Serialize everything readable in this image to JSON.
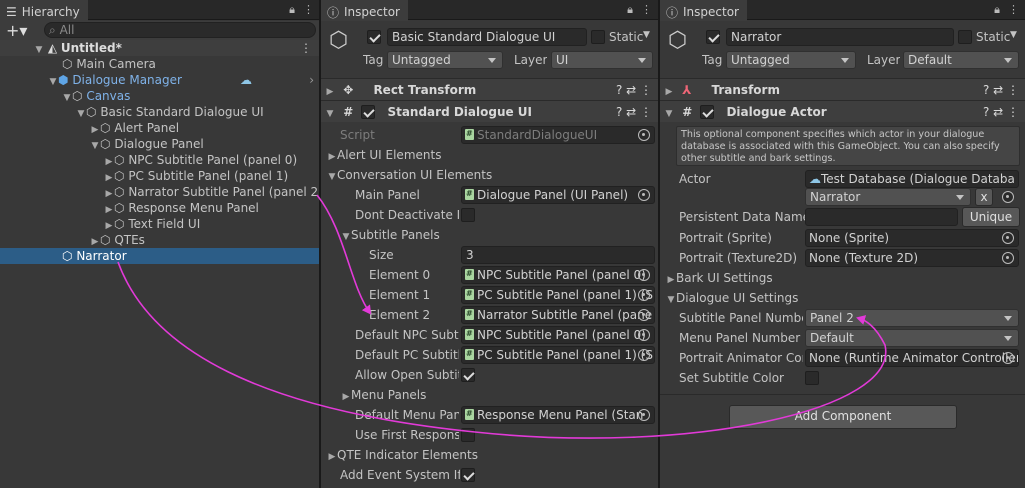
{
  "hierarchy": {
    "tab_label": "Hierarchy",
    "search_placeholder": "All",
    "scene": "Untitled*",
    "items": [
      {
        "label": "Main Camera"
      },
      {
        "label": "Dialogue Manager"
      },
      {
        "label": "Canvas"
      },
      {
        "label": "Basic Standard Dialogue UI"
      },
      {
        "label": "Alert Panel"
      },
      {
        "label": "Dialogue Panel"
      },
      {
        "label": "NPC Subtitle Panel (panel 0)"
      },
      {
        "label": "PC Subtitle Panel (panel 1)"
      },
      {
        "label": "Narrator Subtitle Panel (panel 2)"
      },
      {
        "label": "Response Menu Panel"
      },
      {
        "label": "Text Field UI"
      },
      {
        "label": "QTEs"
      },
      {
        "label": "Narrator"
      }
    ]
  },
  "inspector1": {
    "tab_label": "Inspector",
    "object_name": "Basic Standard Dialogue UI",
    "static_label": "Static",
    "tag_label": "Tag",
    "tag_value": "Untagged",
    "layer_label": "Layer",
    "layer_value": "UI",
    "rect_transform": "Rect Transform",
    "component": "Standard Dialogue UI",
    "script_label": "Script",
    "script_value": "StandardDialogueUI",
    "alert_ui": "Alert UI Elements",
    "conv_ui": "Conversation UI Elements",
    "main_panel_label": "Main Panel",
    "main_panel_value": "Dialogue Panel (UI Panel)",
    "dont_deactivate": "Dont Deactivate M",
    "subtitle_panels": "Subtitle Panels",
    "size_label": "Size",
    "size_value": "3",
    "el0_label": "Element 0",
    "el0_value": "NPC Subtitle Panel (panel 0)",
    "el1_label": "Element 1",
    "el1_value": "PC Subtitle Panel (panel 1) (S",
    "el2_label": "Element 2",
    "el2_value": "Narrator Subtitle Panel (pane",
    "def_npc_label": "Default NPC Subtit",
    "def_npc_value": "NPC Subtitle Panel (panel 0)",
    "def_pc_label": "Default PC Subtitle",
    "def_pc_value": "PC Subtitle Panel (panel 1) (S",
    "allow_open": "Allow Open Subtitl",
    "menu_panels": "Menu Panels",
    "def_menu_label": "Default Menu Pane",
    "def_menu_value": "Response Menu Panel (Stan",
    "use_first": "Use First Response",
    "qte": "QTE Indicator Elements",
    "add_event": "Add Event System If N"
  },
  "inspector2": {
    "tab_label": "Inspector",
    "object_name": "Narrator",
    "static_label": "Static",
    "tag_label": "Tag",
    "tag_value": "Untagged",
    "layer_label": "Layer",
    "layer_value": "Default",
    "transform": "Transform",
    "component": "Dialogue Actor",
    "help": "This optional component specifies which actor in your dialogue database is associated with this GameObject. You can also specify other subtitle and bark settings.",
    "actor_label": "Actor",
    "actor_db": "Test Database (Dialogue Databa",
    "actor_value": "Narrator",
    "x_button": "x",
    "persistent_label": "Persistent Data Name",
    "unique_button": "Unique",
    "portrait_sprite_label": "Portrait (Sprite)",
    "portrait_sprite_value": "None (Sprite)",
    "portrait_tex_label": "Portrait (Texture2D)",
    "portrait_tex_value": "None (Texture 2D)",
    "bark_ui": "Bark UI Settings",
    "dialogue_ui": "Dialogue UI Settings",
    "subtitle_panel_label": "Subtitle Panel Number",
    "subtitle_panel_value": "Panel 2",
    "menu_panel_label": "Menu Panel Number",
    "menu_panel_value": "Default",
    "animator_label": "Portrait Animator Cont",
    "animator_value": "None (Runtime Animator Controller",
    "set_color_label": "Set Subtitle Color",
    "add_component": "Add Component"
  },
  "colors": {
    "accent": "#e23ad8",
    "selection": "#2c5d87",
    "link": "#7fb2e8"
  }
}
